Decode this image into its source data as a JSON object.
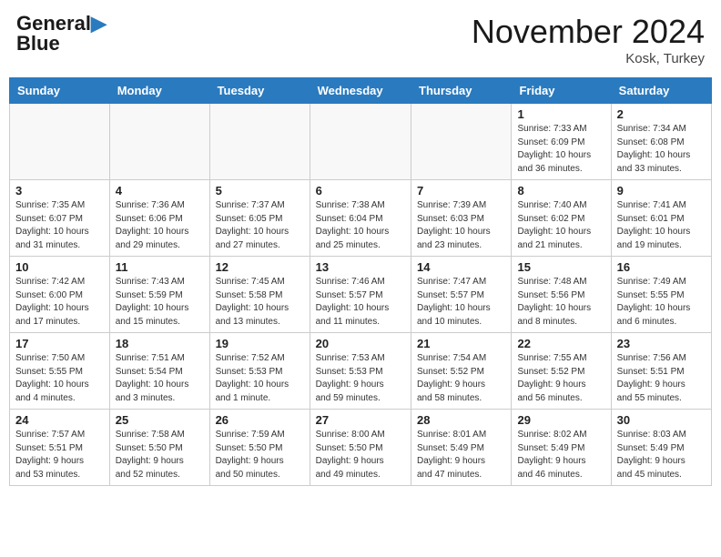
{
  "header": {
    "logo_line1": "General",
    "logo_line2": "Blue",
    "title": "November 2024",
    "subtitle": "Kosk, Turkey"
  },
  "columns": [
    "Sunday",
    "Monday",
    "Tuesday",
    "Wednesday",
    "Thursday",
    "Friday",
    "Saturday"
  ],
  "weeks": [
    [
      {
        "day": "",
        "info": ""
      },
      {
        "day": "",
        "info": ""
      },
      {
        "day": "",
        "info": ""
      },
      {
        "day": "",
        "info": ""
      },
      {
        "day": "",
        "info": ""
      },
      {
        "day": "1",
        "info": "Sunrise: 7:33 AM\nSunset: 6:09 PM\nDaylight: 10 hours\nand 36 minutes."
      },
      {
        "day": "2",
        "info": "Sunrise: 7:34 AM\nSunset: 6:08 PM\nDaylight: 10 hours\nand 33 minutes."
      }
    ],
    [
      {
        "day": "3",
        "info": "Sunrise: 7:35 AM\nSunset: 6:07 PM\nDaylight: 10 hours\nand 31 minutes."
      },
      {
        "day": "4",
        "info": "Sunrise: 7:36 AM\nSunset: 6:06 PM\nDaylight: 10 hours\nand 29 minutes."
      },
      {
        "day": "5",
        "info": "Sunrise: 7:37 AM\nSunset: 6:05 PM\nDaylight: 10 hours\nand 27 minutes."
      },
      {
        "day": "6",
        "info": "Sunrise: 7:38 AM\nSunset: 6:04 PM\nDaylight: 10 hours\nand 25 minutes."
      },
      {
        "day": "7",
        "info": "Sunrise: 7:39 AM\nSunset: 6:03 PM\nDaylight: 10 hours\nand 23 minutes."
      },
      {
        "day": "8",
        "info": "Sunrise: 7:40 AM\nSunset: 6:02 PM\nDaylight: 10 hours\nand 21 minutes."
      },
      {
        "day": "9",
        "info": "Sunrise: 7:41 AM\nSunset: 6:01 PM\nDaylight: 10 hours\nand 19 minutes."
      }
    ],
    [
      {
        "day": "10",
        "info": "Sunrise: 7:42 AM\nSunset: 6:00 PM\nDaylight: 10 hours\nand 17 minutes."
      },
      {
        "day": "11",
        "info": "Sunrise: 7:43 AM\nSunset: 5:59 PM\nDaylight: 10 hours\nand 15 minutes."
      },
      {
        "day": "12",
        "info": "Sunrise: 7:45 AM\nSunset: 5:58 PM\nDaylight: 10 hours\nand 13 minutes."
      },
      {
        "day": "13",
        "info": "Sunrise: 7:46 AM\nSunset: 5:57 PM\nDaylight: 10 hours\nand 11 minutes."
      },
      {
        "day": "14",
        "info": "Sunrise: 7:47 AM\nSunset: 5:57 PM\nDaylight: 10 hours\nand 10 minutes."
      },
      {
        "day": "15",
        "info": "Sunrise: 7:48 AM\nSunset: 5:56 PM\nDaylight: 10 hours\nand 8 minutes."
      },
      {
        "day": "16",
        "info": "Sunrise: 7:49 AM\nSunset: 5:55 PM\nDaylight: 10 hours\nand 6 minutes."
      }
    ],
    [
      {
        "day": "17",
        "info": "Sunrise: 7:50 AM\nSunset: 5:55 PM\nDaylight: 10 hours\nand 4 minutes."
      },
      {
        "day": "18",
        "info": "Sunrise: 7:51 AM\nSunset: 5:54 PM\nDaylight: 10 hours\nand 3 minutes."
      },
      {
        "day": "19",
        "info": "Sunrise: 7:52 AM\nSunset: 5:53 PM\nDaylight: 10 hours\nand 1 minute."
      },
      {
        "day": "20",
        "info": "Sunrise: 7:53 AM\nSunset: 5:53 PM\nDaylight: 9 hours\nand 59 minutes."
      },
      {
        "day": "21",
        "info": "Sunrise: 7:54 AM\nSunset: 5:52 PM\nDaylight: 9 hours\nand 58 minutes."
      },
      {
        "day": "22",
        "info": "Sunrise: 7:55 AM\nSunset: 5:52 PM\nDaylight: 9 hours\nand 56 minutes."
      },
      {
        "day": "23",
        "info": "Sunrise: 7:56 AM\nSunset: 5:51 PM\nDaylight: 9 hours\nand 55 minutes."
      }
    ],
    [
      {
        "day": "24",
        "info": "Sunrise: 7:57 AM\nSunset: 5:51 PM\nDaylight: 9 hours\nand 53 minutes."
      },
      {
        "day": "25",
        "info": "Sunrise: 7:58 AM\nSunset: 5:50 PM\nDaylight: 9 hours\nand 52 minutes."
      },
      {
        "day": "26",
        "info": "Sunrise: 7:59 AM\nSunset: 5:50 PM\nDaylight: 9 hours\nand 50 minutes."
      },
      {
        "day": "27",
        "info": "Sunrise: 8:00 AM\nSunset: 5:50 PM\nDaylight: 9 hours\nand 49 minutes."
      },
      {
        "day": "28",
        "info": "Sunrise: 8:01 AM\nSunset: 5:49 PM\nDaylight: 9 hours\nand 47 minutes."
      },
      {
        "day": "29",
        "info": "Sunrise: 8:02 AM\nSunset: 5:49 PM\nDaylight: 9 hours\nand 46 minutes."
      },
      {
        "day": "30",
        "info": "Sunrise: 8:03 AM\nSunset: 5:49 PM\nDaylight: 9 hours\nand 45 minutes."
      }
    ]
  ]
}
